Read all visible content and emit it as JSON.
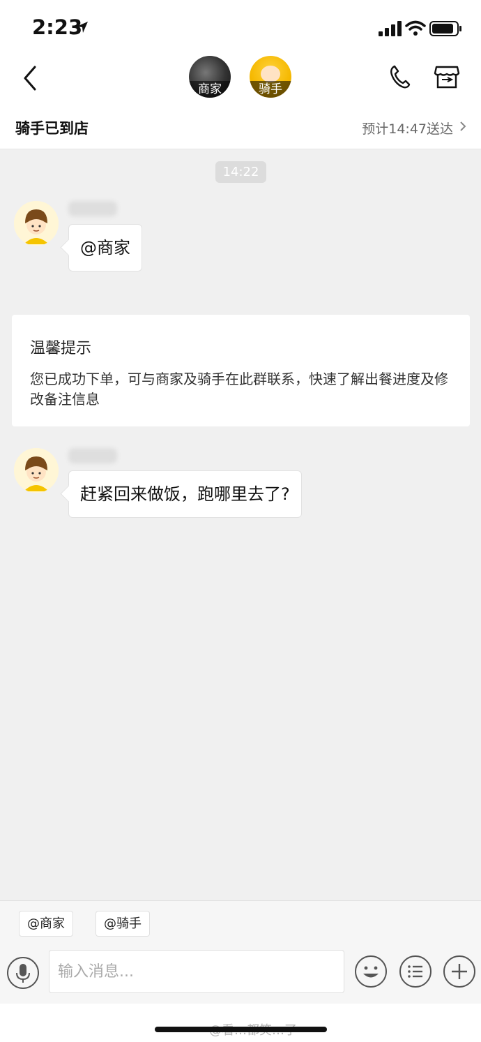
{
  "status_bar": {
    "time": "2:23"
  },
  "header": {
    "participants": [
      {
        "label": "商家"
      },
      {
        "label": "骑手"
      }
    ]
  },
  "order": {
    "status": "骑手已到店",
    "eta": "预计14:47送达"
  },
  "chat": {
    "timestamp": "14:22",
    "messages": [
      {
        "text": "@商家"
      },
      {
        "text": "赶紧回来做饭，跑哪里去了?"
      }
    ],
    "tip": {
      "title": "温馨提示",
      "body": "您已成功下单，可与商家及骑手在此群联系，快速了解出餐进度及修改备注信息"
    }
  },
  "quick_mentions": [
    "@商家",
    "@骑手"
  ],
  "input": {
    "placeholder": "输入消息..."
  },
  "watermark": "@看…都笑…了"
}
